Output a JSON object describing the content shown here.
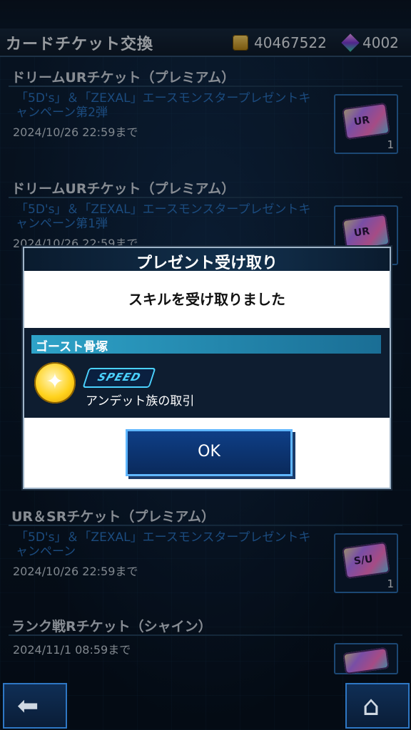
{
  "header": {
    "title": "カードチケット交換",
    "coins": "40467522",
    "gems": "4002"
  },
  "items": [
    {
      "title": "ドリームURチケット（プレミアム）",
      "desc": "「5D's」＆「ZEXAL」エースモンスタープレゼントキャンペーン第2弾",
      "date": "2024/10/26 22:59まで",
      "ticket_label": "UR",
      "count": "1"
    },
    {
      "title": "ドリームURチケット（プレミアム）",
      "desc": "「5D's」＆「ZEXAL」エースモンスタープレゼントキャンペーン第1弾",
      "date": "2024/10/26 22:59まで",
      "ticket_label": "UR",
      "count": ""
    },
    {
      "title": "UR＆SRチケット（プレミアム）",
      "desc": "「5D's」＆「ZEXAL」エースモンスタープレゼントキャンペーン",
      "date": "2024/10/26 22:59まで",
      "ticket_label": "S/U",
      "count": "1"
    },
    {
      "title": "ランク戦Rチケット（シャイン）",
      "desc": "",
      "date": "2024/11/1 08:59まで",
      "ticket_label": "",
      "count": ""
    }
  ],
  "modal": {
    "title": "プレゼント受け取り",
    "message": "スキルを受け取りました",
    "reward_name": "ゴースト骨塚",
    "speed_logo": "SPEED",
    "skill_name": "アンデット族の取引",
    "ok_label": "OK"
  },
  "nav": {
    "back_icon": "arrow-left-icon",
    "home_icon": "home-icon"
  }
}
